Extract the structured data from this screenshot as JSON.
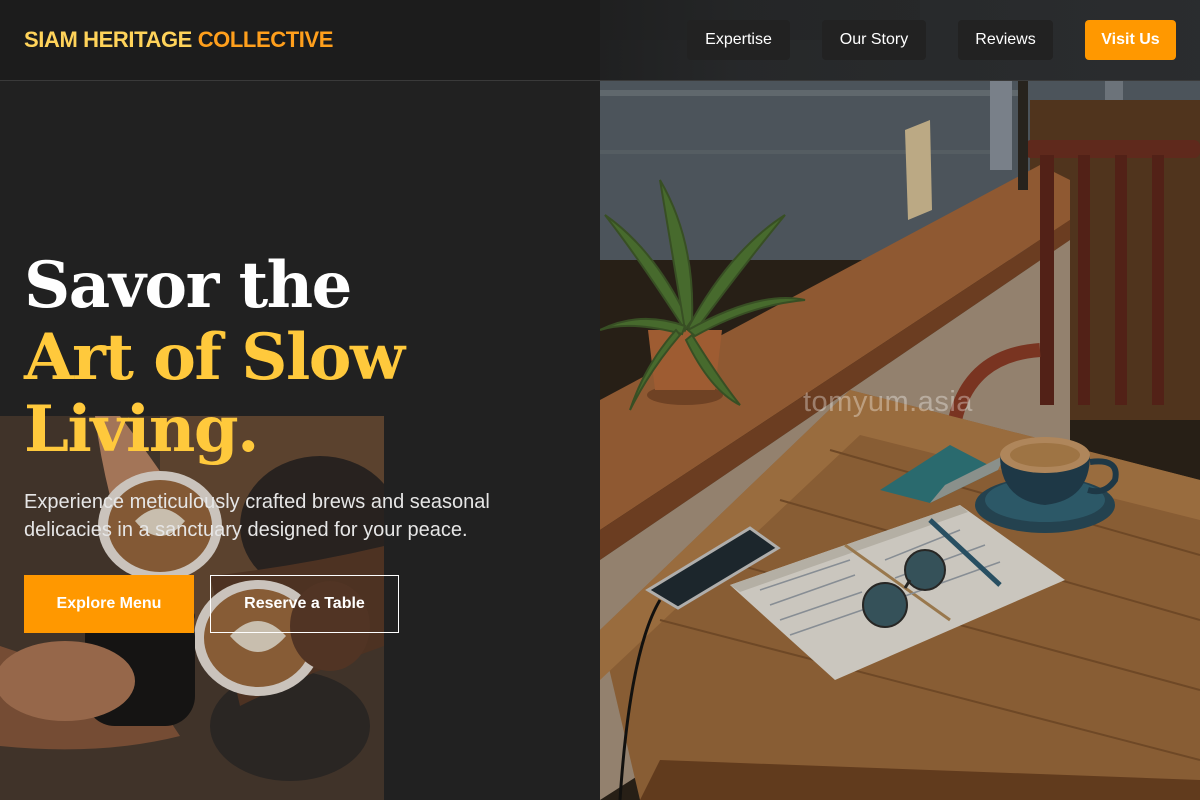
{
  "header": {
    "brand_part1": "SIAM HERITAGE",
    "brand_part2": "COLLECTIVE",
    "nav": {
      "expertise": "Expertise",
      "our_story": "Our Story",
      "reviews": "Reviews",
      "visit_us": "Visit Us"
    }
  },
  "hero": {
    "headline_line1": "Savor the",
    "headline_line2": "Art of Slow Living.",
    "subtitle": "Experience meticulously crafted brews and seasonal delicacies in a sanctuary designed for your peace.",
    "explore_button": "Explore Menu",
    "reserve_button": "Reserve a Table"
  },
  "watermark": "tomyum.asia",
  "colors": {
    "accent_orange": "#ff9800",
    "accent_yellow": "#ffc93c",
    "background": "#212121"
  }
}
